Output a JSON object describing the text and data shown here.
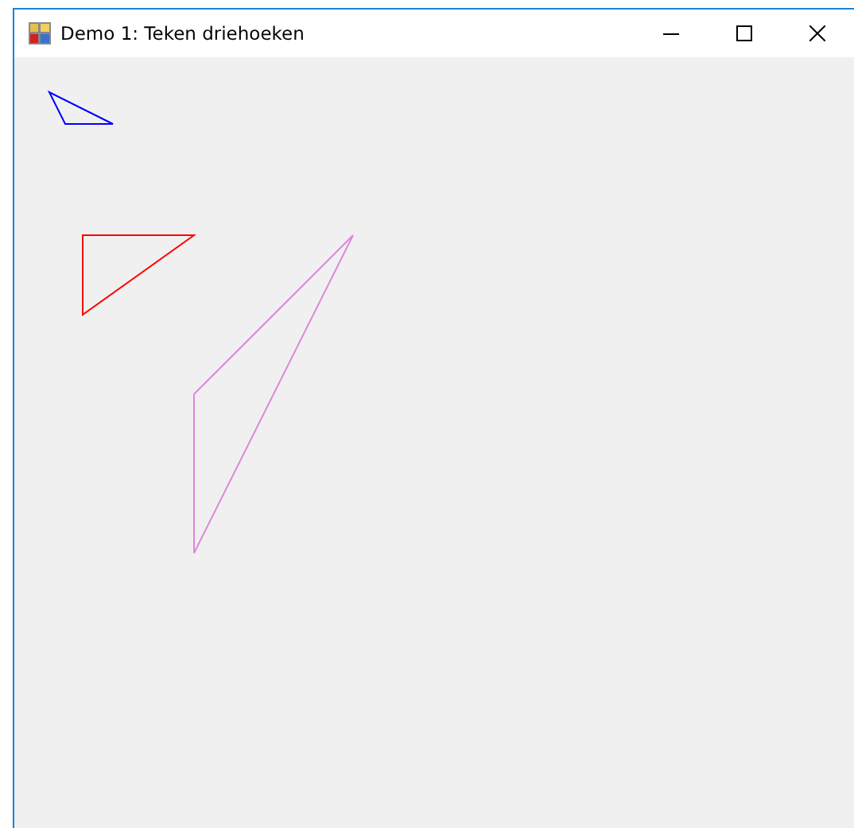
{
  "window": {
    "title": "Demo 1: Teken driehoeken"
  },
  "triangles": [
    {
      "color": "#0000ff"
    },
    {
      "color": "#ff0000"
    },
    {
      "color": "#dd88dd"
    }
  ]
}
